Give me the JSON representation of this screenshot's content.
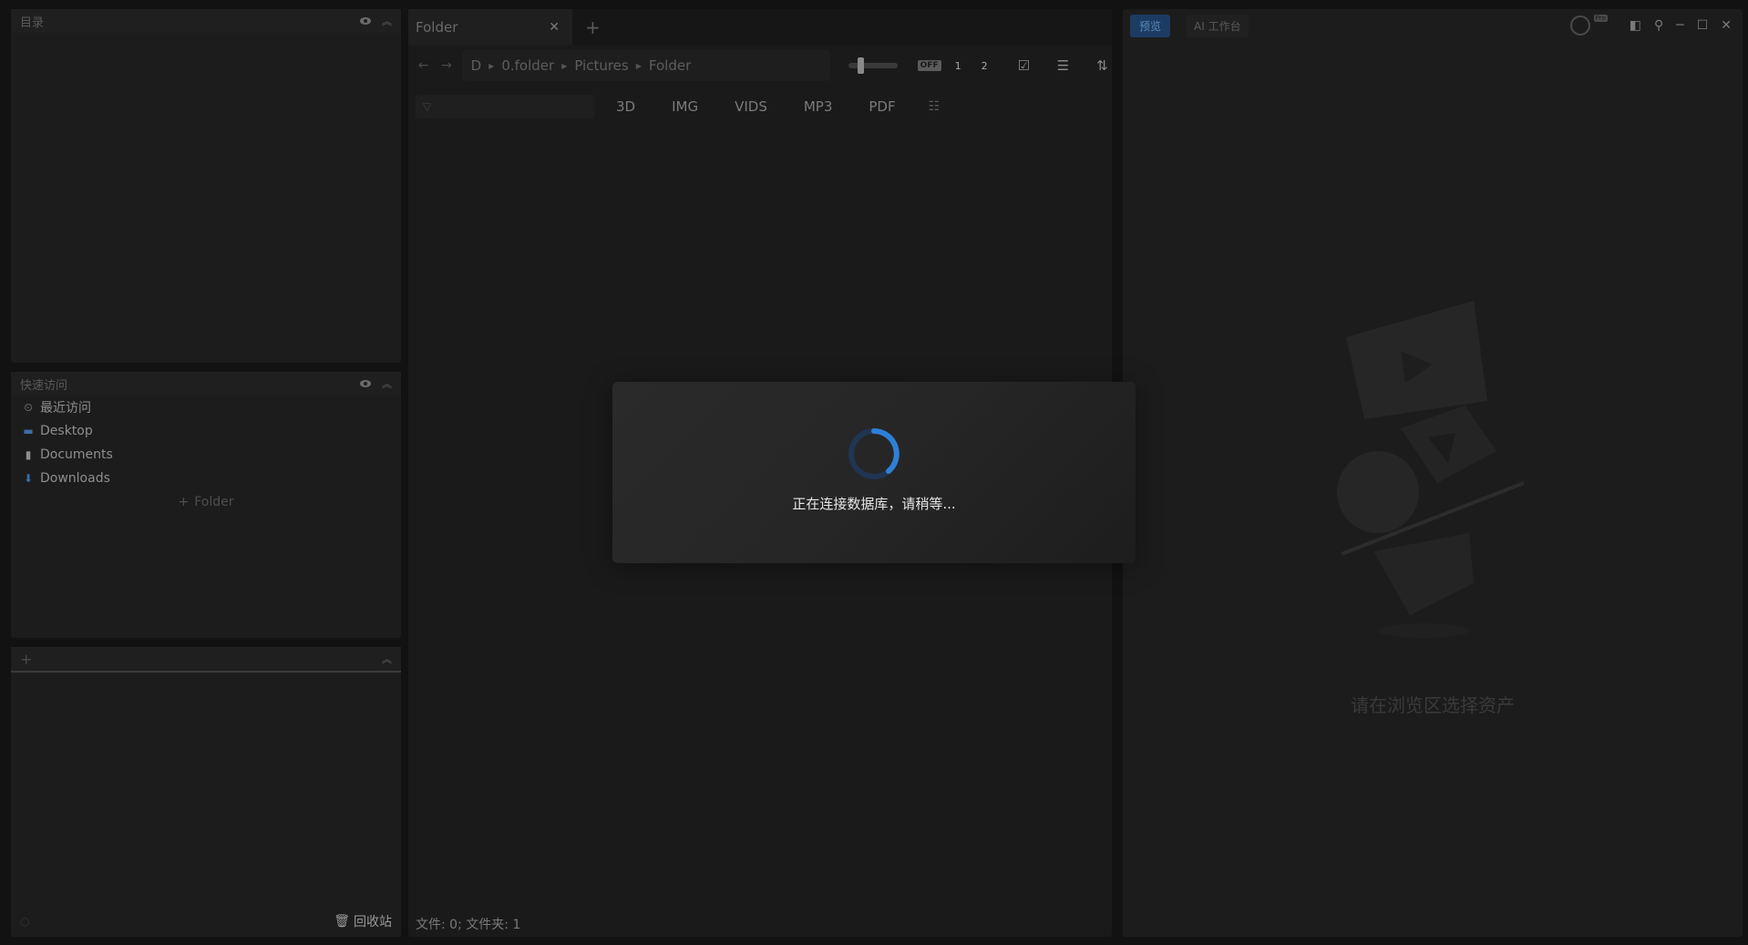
{
  "left": {
    "catalog": {
      "title": "目录"
    },
    "quick_access": {
      "title": "快速访问",
      "items": [
        {
          "label": "最近访问",
          "icon": "clock-icon"
        },
        {
          "label": "Desktop",
          "icon": "desktop-folder-icon",
          "color": "#3a6ea8"
        },
        {
          "label": "Documents",
          "icon": "document-icon"
        },
        {
          "label": "Downloads",
          "icon": "download-icon",
          "color": "#3a6ea8"
        }
      ],
      "add_folder_label": "Folder"
    },
    "third_panel": {
      "add_symbol": "+"
    },
    "trash_label": "回收站"
  },
  "middle": {
    "tab": {
      "title": "Folder"
    },
    "breadcrumb": [
      "D",
      "0.folder",
      "Pictures",
      "Folder"
    ],
    "view_toggle": {
      "off_label": "OFF",
      "options": [
        "1",
        "2"
      ]
    },
    "filters": [
      "3D",
      "IMG",
      "VIDS",
      "MP3",
      "PDF"
    ],
    "status": "文件: 0; 文件夹: 1"
  },
  "right": {
    "tabs": {
      "preview": "预览",
      "ai": "AI 工作台"
    },
    "pro_badge": "Pro",
    "empty_message": "请在浏览区选择资产"
  },
  "dialog": {
    "message": "正在连接数据库，请稍等...",
    "accent_color": "#2f7fd6"
  }
}
